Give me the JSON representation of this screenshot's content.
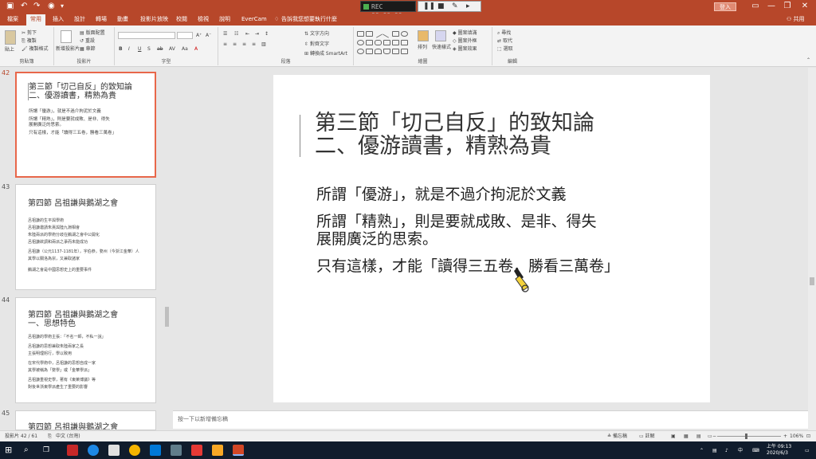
{
  "titlebar": {
    "recorder_text": "REC 00:00:00",
    "signin_label": "登入",
    "minimize": "—",
    "restore": "❐",
    "close": "✕"
  },
  "tabs": {
    "items": [
      "檔案",
      "常用",
      "插入",
      "設計",
      "轉場",
      "動畫",
      "投影片放映",
      "校閱",
      "檢視",
      "說明",
      "EverCam",
      "告訴我您想要執行什麼"
    ],
    "share": "共用"
  },
  "ribbon": {
    "clipboard": {
      "label": "剪貼簿",
      "paste": "貼上",
      "cut": "剪下",
      "copy": "複製",
      "format_painter": "複製格式"
    },
    "slides": {
      "label": "投影片",
      "new_slide": "新增投影片",
      "layout": "版面配置",
      "reset": "重設",
      "section": "章節"
    },
    "font": {
      "label": "字型"
    },
    "paragraph": {
      "label": "段落",
      "text_direction": "文字方向",
      "align_text": "對齊文字",
      "smartart": "轉換成 SmartArt"
    },
    "drawing": {
      "label": "繪圖",
      "arrange": "排列",
      "quick_styles": "快速樣式",
      "shape_fill": "圖案填滿",
      "shape_outline": "圖案外框",
      "shape_effects": "圖案效果"
    },
    "editing": {
      "label": "編輯",
      "find": "尋找",
      "replace": "取代",
      "select": "選取"
    }
  },
  "slides_panel": [
    {
      "number": "42",
      "title_lines": [
        "第三節「切己自反」的致知論",
        "二、優游讀書，精熟為貴"
      ],
      "body_lines": [
        "所謂「優游」，就是不過介拘泥於文義",
        "所謂「精熟」，則是要就成敗、是非、得失",
        "展開廣泛的思索。",
        "只有這樣，才能「讀得三五卷，勝看三萬卷」"
      ]
    },
    {
      "number": "43",
      "title_lines": [
        "第四節 呂祖謙與鵝湖之會"
      ],
      "body_lines": [
        "呂祖謙的生平與學術",
        "呂祖謙邀請朱熹與陸九淵相會",
        "朱陸兩派的學術分歧在鵝湖之會中公開化",
        "呂祖謙欲調和兩派之爭而未能成功",
        "呂祖謙（公元1137-1181年），字伯恭，婺州（今浙江金華）人",
        "其學以關洛為宗，又兼取諸家",
        "鵝湖之會是中國思想史上的重要事件"
      ]
    },
    {
      "number": "44",
      "title_lines": [
        "第四節 呂祖謙與鵝湖之會",
        "一、思想特色"
      ],
      "body_lines": [
        "呂祖謙的學術主張：「不名一師，不私一說」",
        "呂祖謙的思想兼取朱陸兩家之長",
        "主張明理躬行，學以致用",
        "在宋代學術中，呂祖謙的思想自成一家",
        "其學被稱為「婺學」或「金華學派」",
        "呂祖謙重視史學，著有《東萊博議》等",
        "對後世浙東學派產生了重要的影響"
      ]
    },
    {
      "number": "45",
      "title_lines": [
        "第四節 呂祖謙與鵝湖之會"
      ],
      "body_lines": []
    }
  ],
  "slide": {
    "title_line1": "第三節「切己自反」的致知論",
    "title_line2": "二、優游讀書，精熟為貴",
    "body": [
      "所謂「優游」，就是不過介拘泥於文義",
      "所謂「精熟」，則是要就成敗、是非、得失",
      "展開廣泛的思索。",
      "只有這樣，才能「讀得三五卷，勝看三萬卷」"
    ]
  },
  "notes": {
    "placeholder": "按一下以新增備忘稿"
  },
  "statusbar": {
    "slide_count": "投影片 42 / 61",
    "language": "中文 (台灣)",
    "notes_btn": "備忘稿",
    "comments_btn": "註解",
    "zoom_minus": "−",
    "zoom_plus": "+",
    "zoom": "106%"
  },
  "taskbar": {
    "time": "上午 09:13",
    "date": "2020/6/3"
  },
  "colors": {
    "accent": "#b7472a",
    "selected_thumb_border": "#e8674a"
  }
}
